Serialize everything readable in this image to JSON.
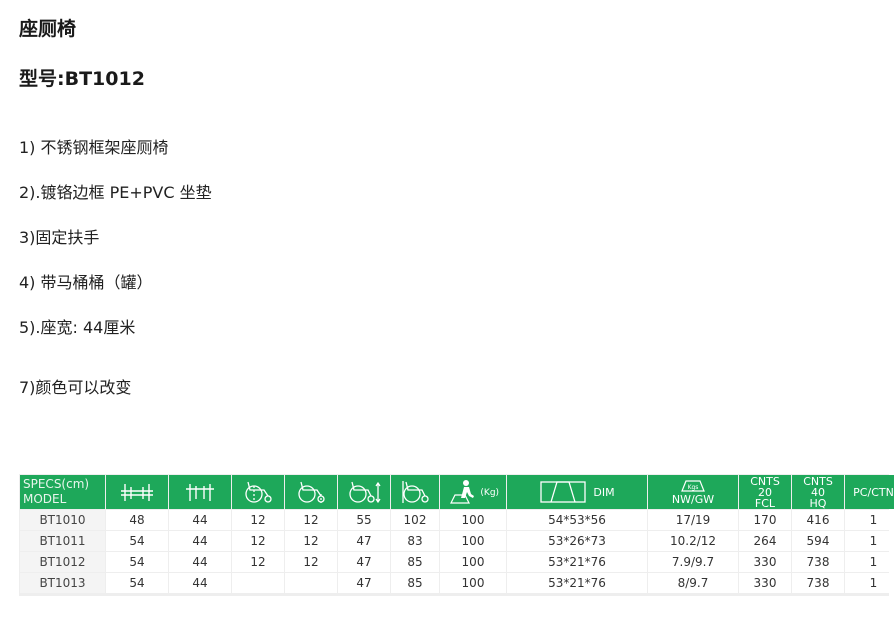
{
  "product": {
    "title": "座厕椅",
    "model_line": "型号:BT1012"
  },
  "features": [
    "1) 不锈钢框架座厕椅",
    "2).镀铬边框 PE+PVC 坐垫",
    "3)固定扶手",
    "4) 带马桶桶（罐）",
    "5).座宽: 44厘米",
    "7)颜色可以改变"
  ],
  "table": {
    "header": {
      "specs_label": "SPECS(cm)",
      "model_label": "MODEL",
      "dim_label": "DIM",
      "kgs_label": "Kgs",
      "nwgw_label": "NW/GW",
      "kg_label": "(Kg)",
      "cnts20": [
        "CNTS",
        "20",
        "FCL"
      ],
      "cnts40": [
        "CNTS",
        "40",
        "HQ"
      ],
      "pcctn_label": "PC/CTN"
    },
    "icons": [
      "overall-width-icon",
      "seat-width-icon",
      "wheelchair-rear-wheel-icon",
      "wheelchair-front-wheel-icon",
      "wheelchair-height-icon",
      "wheelchair-length-icon",
      "max-user-weight-icon",
      "carton-dimension-icon",
      "weight-scale-icon"
    ],
    "rows": [
      [
        "BT1010",
        "48",
        "44",
        "12",
        "12",
        "55",
        "102",
        "100",
        "54*53*56",
        "17/19",
        "170",
        "416",
        "1"
      ],
      [
        "BT1011",
        "54",
        "44",
        "12",
        "12",
        "47",
        "83",
        "100",
        "53*26*73",
        "10.2/12",
        "264",
        "594",
        "1"
      ],
      [
        "BT1012",
        "54",
        "44",
        "12",
        "12",
        "47",
        "85",
        "100",
        "53*21*76",
        "7.9/9.7",
        "330",
        "738",
        "1"
      ],
      [
        "BT1013",
        "54",
        "44",
        "",
        "",
        "47",
        "85",
        "100",
        "53*21*76",
        "8/9.7",
        "330",
        "738",
        "1"
      ]
    ]
  },
  "colors": {
    "header_green": "#1ea85a",
    "text": "#222222"
  }
}
